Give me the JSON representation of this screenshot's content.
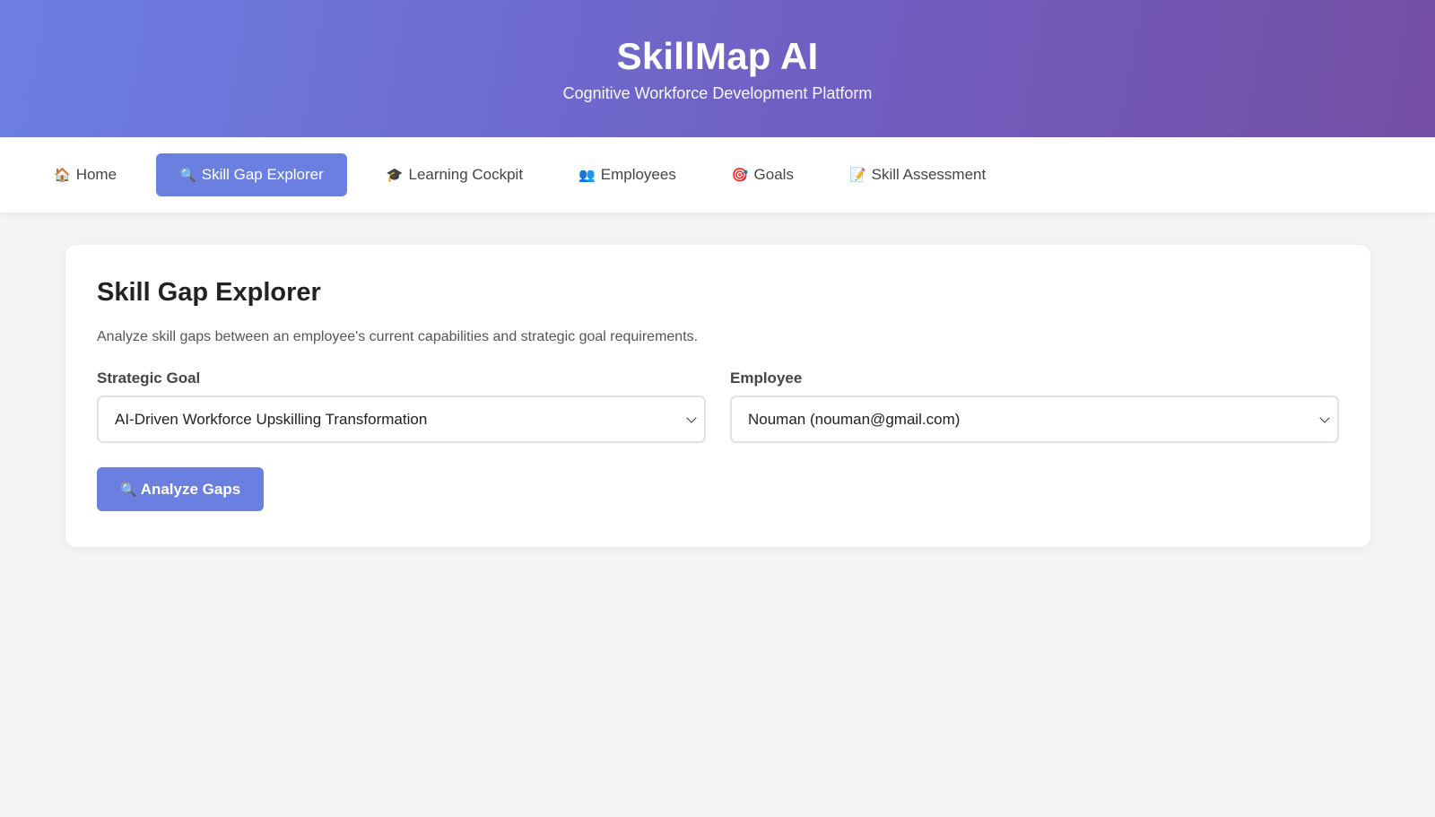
{
  "header": {
    "title": "SkillMap AI",
    "subtitle": "Cognitive Workforce Development Platform"
  },
  "nav": {
    "items": [
      {
        "icon": "🏠",
        "label": "Home",
        "icon_name": "home-icon"
      },
      {
        "icon": "🔍",
        "label": "Skill Gap Explorer",
        "icon_name": "magnifier-icon",
        "active": true
      },
      {
        "icon": "🎓",
        "label": "Learning Cockpit",
        "icon_name": "graduation-cap-icon"
      },
      {
        "icon": "👥",
        "label": "Employees",
        "icon_name": "people-icon"
      },
      {
        "icon": "🎯",
        "label": "Goals",
        "icon_name": "target-icon"
      },
      {
        "icon": "📝",
        "label": "Skill Assessment",
        "icon_name": "memo-icon"
      }
    ]
  },
  "main": {
    "title": "Skill Gap Explorer",
    "description": "Analyze skill gaps between an employee's current capabilities and strategic goal requirements.",
    "goal_field": {
      "label": "Strategic Goal",
      "value": "AI-Driven Workforce Upskilling Transformation"
    },
    "employee_field": {
      "label": "Employee",
      "value": "Nouman (nouman@gmail.com)"
    },
    "analyze_button": {
      "icon": "🔍",
      "label": "Analyze Gaps"
    }
  },
  "colors": {
    "accent": "#6b7fe0",
    "header_gradient_start": "#6c7fe3",
    "header_gradient_end": "#744ea4",
    "background": "#f4f4f4"
  }
}
